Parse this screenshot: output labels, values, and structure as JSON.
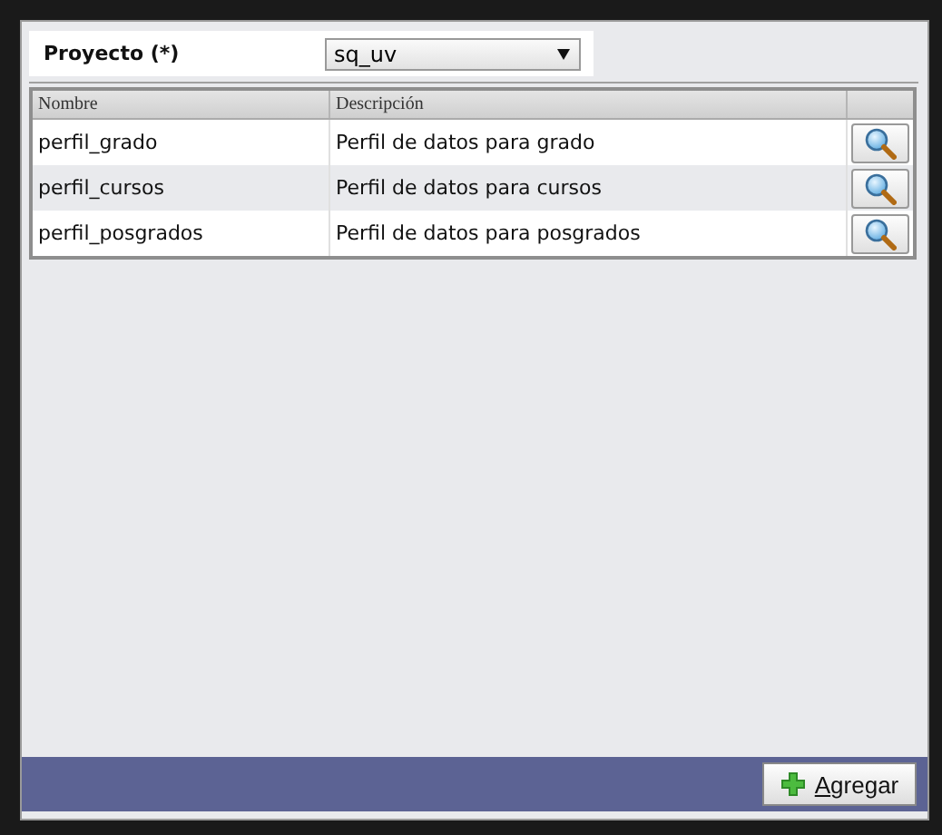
{
  "form": {
    "label": "Proyecto (*)",
    "select_value": "sq_uv"
  },
  "table": {
    "columns": [
      "Nombre",
      "Descripción"
    ],
    "rows": [
      {
        "nombre": "perfil_grado",
        "descripcion": "Perfil de datos para grado"
      },
      {
        "nombre": "perfil_cursos",
        "descripcion": "Perfil de datos para cursos"
      },
      {
        "nombre": "perfil_posgrados",
        "descripcion": "Perfil de datos para posgrados"
      }
    ]
  },
  "footer": {
    "button": "Agregar"
  }
}
